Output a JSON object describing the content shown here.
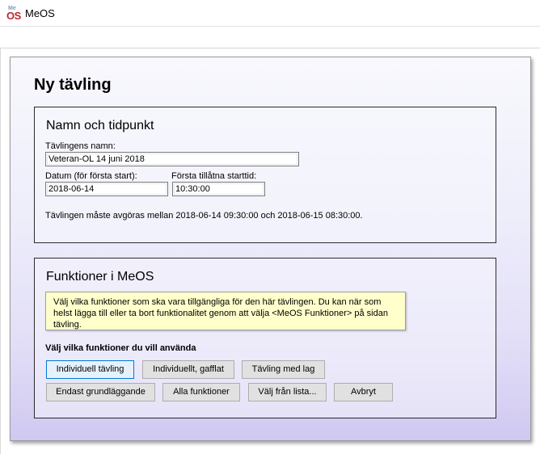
{
  "window": {
    "title": "MeOS",
    "icon_top": "Me",
    "icon_bottom": "OS"
  },
  "page": {
    "title": "Ny tävling"
  },
  "name_section": {
    "title": "Namn och tidpunkt",
    "name_label": "Tävlingens namn:",
    "name_value": "Veteran-OL 14 juni 2018",
    "date_label": "Datum (för första start):",
    "date_value": "2018-06-14",
    "time_label": "Första tillåtna starttid:",
    "time_value": "10:30:00",
    "span_text": "Tävlingen måste avgöras mellan 2018-06-14 09:30:00 och 2018-06-15 08:30:00."
  },
  "functions_section": {
    "title": "Funktioner i MeOS",
    "info_text": "Välj vilka funktioner som ska vara tillgängliga för den här tävlingen. Du kan när som helst lägga till eller ta bort funktionalitet genom att välja <MeOS Funktioner> på sidan tävling.",
    "choose_label": "Välj vilka funktioner du vill använda",
    "buttons": {
      "individual": "Individuell tävling",
      "individual_gafflat": "Individuellt, gafflat",
      "team": "Tävling med lag",
      "basic": "Endast grundläggande",
      "all": "Alla funktioner",
      "from_list": "Välj från lista...",
      "cancel": "Avbryt"
    }
  },
  "colors": {
    "accent": "#0078d7",
    "info_bg": "#ffffcc",
    "logo_red": "#c1272d"
  }
}
